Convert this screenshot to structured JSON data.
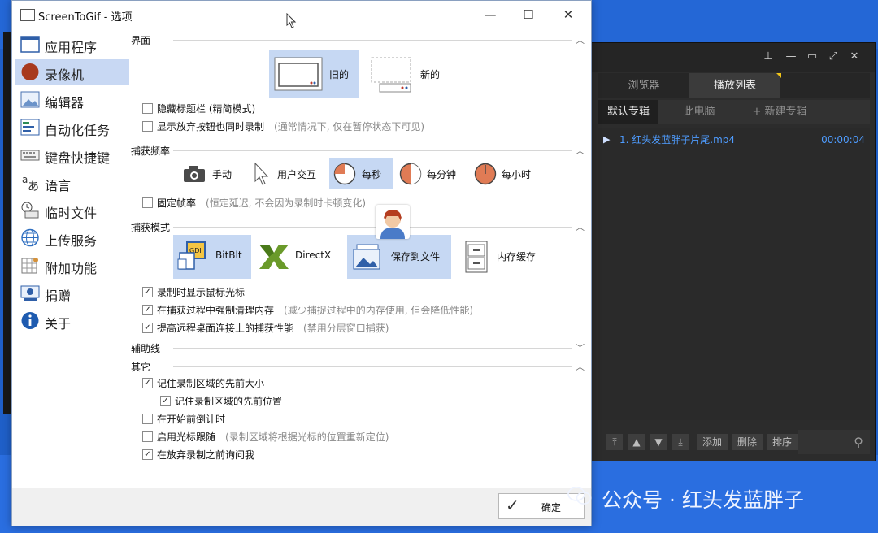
{
  "dialog": {
    "title": "ScreenToGif - 选项",
    "controls": {
      "minimize": "—",
      "maximize": "☐",
      "close": "✕"
    }
  },
  "sidebar": {
    "items": [
      {
        "label": "应用程序",
        "icon": "application-window-icon"
      },
      {
        "label": "录像机",
        "icon": "recorder-icon",
        "active": true
      },
      {
        "label": "编辑器",
        "icon": "editor-image-icon"
      },
      {
        "label": "自动化任务",
        "icon": "automation-tasks-icon"
      },
      {
        "label": "键盘快捷键",
        "icon": "keyboard-icon"
      },
      {
        "label": "语言",
        "icon": "language-icon"
      },
      {
        "label": "临时文件",
        "icon": "temp-files-icon"
      },
      {
        "label": "上传服务",
        "icon": "globe-icon"
      },
      {
        "label": "附加功能",
        "icon": "extras-icon"
      },
      {
        "label": "捐赠",
        "icon": "donate-icon"
      },
      {
        "label": "关于",
        "icon": "info-icon"
      }
    ]
  },
  "sections": {
    "interface": "界面",
    "capture_frequency": "捕获频率",
    "capture_mode": "捕获模式",
    "guidelines": "辅助线",
    "other": "其它"
  },
  "interface": {
    "old_label": "旧的",
    "new_label": "新的",
    "hide_titlebar": "隐藏标题栏 (精简模式)",
    "show_discard": "显示放弃按钮也同时录制",
    "show_discard_hint": "(通常情况下, 仅在暂停状态下可见)"
  },
  "frequency": {
    "manual": "手动",
    "interaction": "用户交互",
    "per_second": "每秒",
    "per_minute": "每分钟",
    "per_hour": "每小时",
    "fixed_rate": "固定帧率",
    "fixed_rate_hint": "(恒定延迟, 不会因为录制时卡顿变化)"
  },
  "mode": {
    "bitblt": "BitBlt",
    "directx": "DirectX",
    "save_to_file": "保存到文件",
    "memory_cache": "内存缓存",
    "show_cursor": "录制时显示鼠标光标",
    "force_gc": "在捕获过程中强制清理内存",
    "force_gc_hint": "(减少捕捉过程中的内存使用, 但会降低性能)",
    "remote_perf": "提高远程桌面连接上的捕获性能",
    "remote_perf_hint": "(禁用分层窗口捕获)"
  },
  "other": {
    "remember_size": "记住录制区域的先前大小",
    "remember_position": "记住录制区域的先前位置",
    "countdown": "在开始前倒计时",
    "follow_cursor": "启用光标跟随",
    "follow_cursor_hint": "(录制区域将根据光标的位置重新定位)",
    "ask_discard": "在放弃录制之前询问我"
  },
  "footer": {
    "ok": "确定"
  },
  "player": {
    "tabs": [
      "浏览器",
      "播放列表"
    ],
    "subtabs": [
      "默认专辑",
      "此电脑",
      "+ 新建专辑"
    ],
    "items": [
      {
        "name": "1. 红头发蓝胖子片尾.mp4",
        "duration": "00:00:04"
      }
    ],
    "buttons": [
      "添加",
      "删除",
      "排序"
    ]
  },
  "watermark": "公众号 · 红头发蓝胖子",
  "colors": {
    "selection": "#c6d8f3",
    "desktop": "#1f5fc8",
    "player_text": "#4e9cff"
  }
}
